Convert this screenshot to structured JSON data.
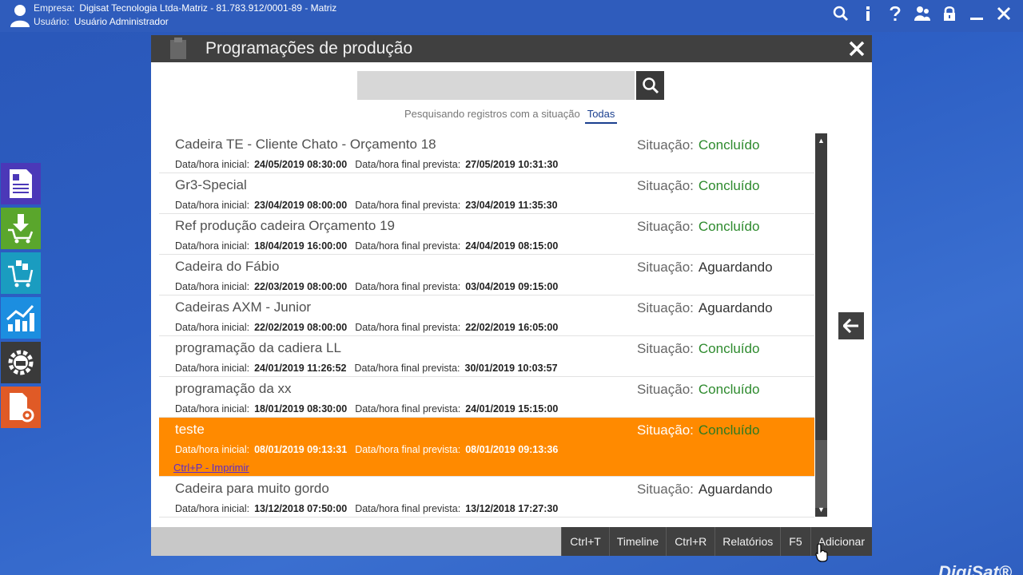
{
  "topbar": {
    "empresa_label": "Empresa:",
    "empresa_value": "Digisat Tecnologia Ltda-Matriz - 81.783.912/0001-89 - Matriz",
    "usuario_label": "Usuário:",
    "usuario_value": "Usuário Administrador",
    "icons": [
      "search-icon",
      "info-icon",
      "help-icon",
      "users-icon",
      "lock-icon",
      "minimize-icon",
      "close-icon"
    ]
  },
  "sidebar": {
    "items": [
      {
        "icon": "document-list-icon",
        "color": "#4b38b8"
      },
      {
        "icon": "download-cart-icon",
        "color": "#5aa62c"
      },
      {
        "icon": "shopping-cart-icon",
        "color": "#1a9cc0"
      },
      {
        "icon": "growth-chart-icon",
        "color": "#1c8ee0"
      },
      {
        "icon": "factory-gear-icon",
        "color": "#3a3a3a"
      },
      {
        "icon": "document-settings-icon",
        "color": "#e05a26"
      }
    ]
  },
  "dialog": {
    "title": "Programações de produção",
    "search_placeholder": "",
    "filter_text": "Pesquisando registros com a situação",
    "filter_value": "Todas",
    "labels": {
      "start": "Data/hora inicial:",
      "end": "Data/hora final prevista:",
      "situation": "Situação:"
    },
    "rows": [
      {
        "name": "Cadeira TE - Cliente Chato - Orçamento 18",
        "start": "24/05/2019 08:30:00",
        "end": "27/05/2019 10:31:30",
        "status": "Concluído",
        "status_kind": "done"
      },
      {
        "name": "Gr3-Special",
        "start": "23/04/2019 08:00:00",
        "end": "23/04/2019 11:35:30",
        "status": "Concluído",
        "status_kind": "done"
      },
      {
        "name": "Ref produção cadeira Orçamento 19",
        "start": "18/04/2019 16:00:00",
        "end": "24/04/2019 08:15:00",
        "status": "Concluído",
        "status_kind": "done"
      },
      {
        "name": "Cadeira do Fábio",
        "start": "22/03/2019 08:00:00",
        "end": "03/04/2019 09:15:00",
        "status": "Aguardando",
        "status_kind": "wait"
      },
      {
        "name": "Cadeiras AXM - Junior",
        "start": "22/02/2019 08:00:00",
        "end": "22/02/2019 16:05:00",
        "status": "Aguardando",
        "status_kind": "wait"
      },
      {
        "name": "programação da cadiera LL",
        "start": "24/01/2019 11:26:52",
        "end": "30/01/2019 10:03:57",
        "status": "Concluído",
        "status_kind": "done"
      },
      {
        "name": "programação da xx",
        "start": "18/01/2019 08:30:00",
        "end": "24/01/2019 15:15:00",
        "status": "Concluído",
        "status_kind": "done"
      },
      {
        "name": "teste",
        "start": "08/01/2019 09:13:31",
        "end": "08/01/2019 09:13:36",
        "status": "Concluído",
        "status_kind": "done",
        "selected": true,
        "print_link": "Ctrl+P - Imprimir"
      },
      {
        "name": "Cadeira para muito gordo",
        "start": "13/12/2018 07:50:00",
        "end": "13/12/2018 17:27:30",
        "status": "Aguardando",
        "status_kind": "wait"
      }
    ],
    "footer": {
      "buttons": [
        {
          "key": "Ctrl+T",
          "label": "Timeline"
        },
        {
          "key": "Ctrl+R",
          "label": "Relatórios"
        },
        {
          "key": "F5",
          "label": "Adicionar"
        }
      ]
    }
  },
  "brand": "DigiSat®",
  "colors": {
    "selected_row": "#ff8a00",
    "status_done": "#2d8a2d",
    "header_dark": "#404040",
    "desktop_blue": "#2d5fc4"
  }
}
